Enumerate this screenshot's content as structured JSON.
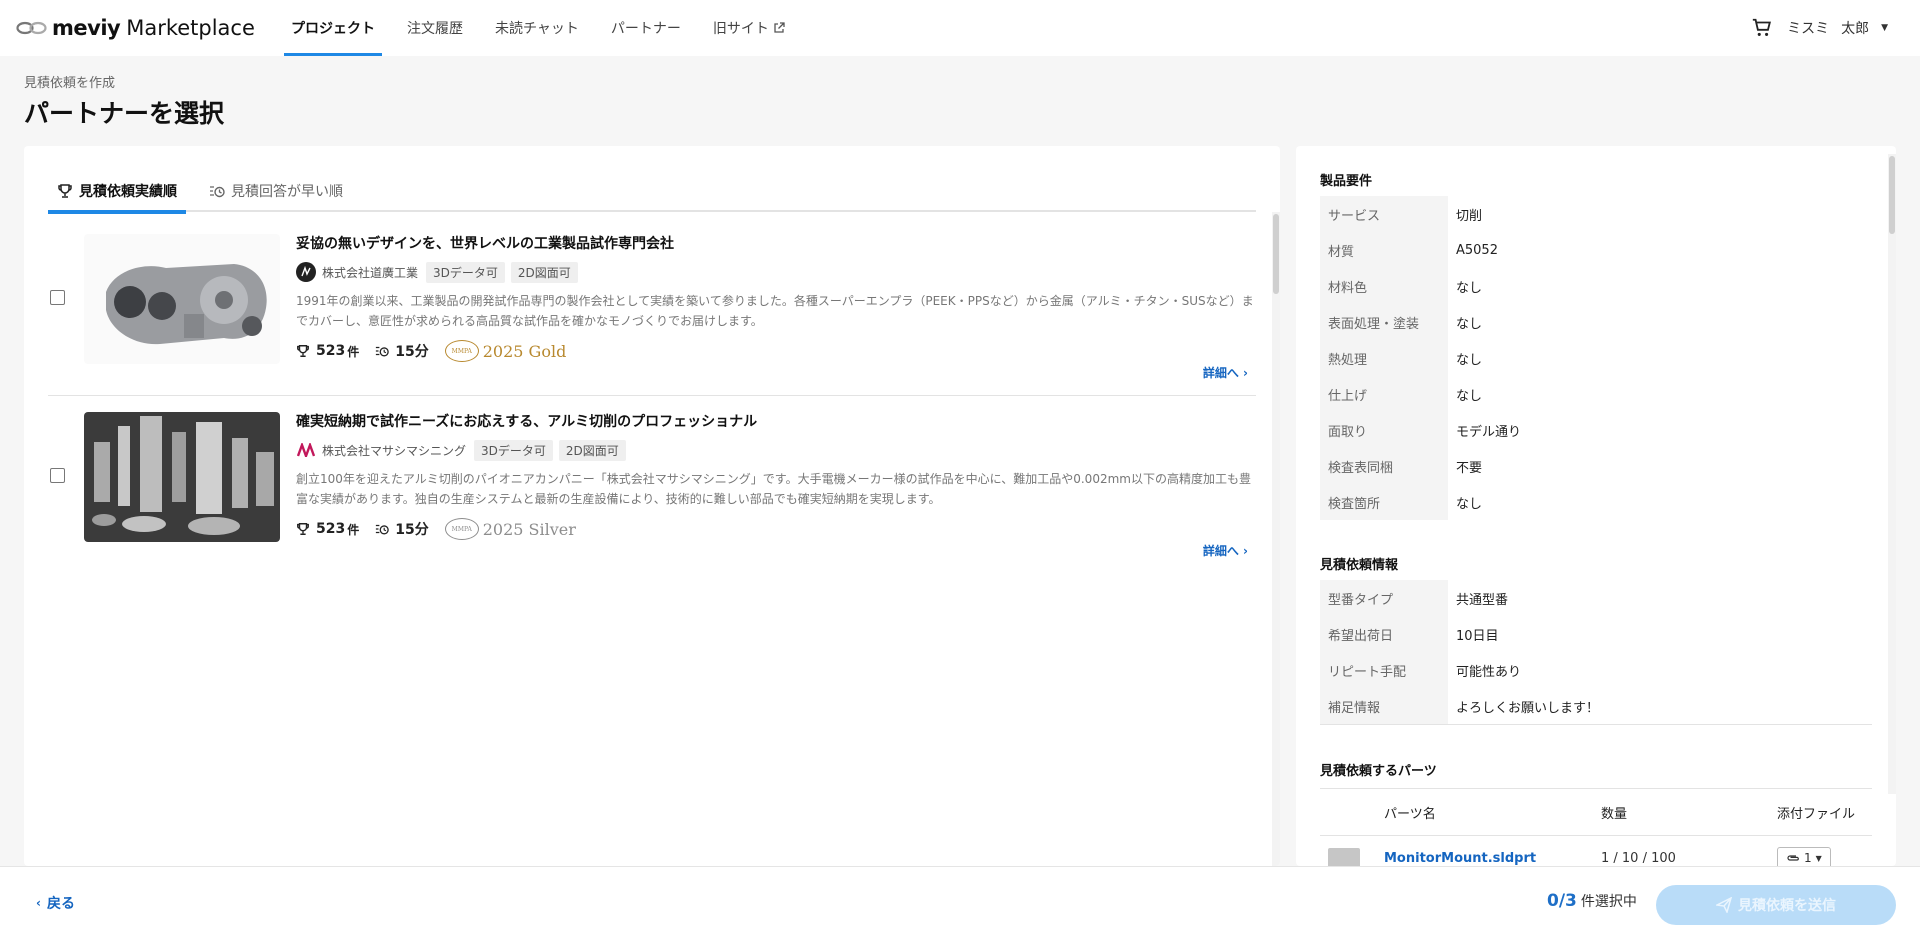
{
  "header": {
    "brand": "meviy",
    "product": "Marketplace",
    "nav": [
      {
        "label": "プロジェクト",
        "active": true
      },
      {
        "label": "注文履歴"
      },
      {
        "label": "未読チャット"
      },
      {
        "label": "パートナー"
      },
      {
        "label": "旧サイト"
      }
    ],
    "user": {
      "last_name": "ミスミ",
      "first_name": "太郎"
    }
  },
  "breadcrumb": "見積依頼を作成",
  "page_title": "パートナーを選択",
  "tabs": [
    {
      "label": "見積依頼実績順",
      "active": true,
      "icon": "trophy-icon"
    },
    {
      "label": "見積回答が早い順",
      "icon": "clock-list-icon"
    }
  ],
  "partners": [
    {
      "title": "妥協の無いデザインを、世界レベルの工業製品試作専門会社",
      "company": "株式会社道廣工業",
      "tags": [
        "3Dデータ可",
        "2D図面可"
      ],
      "description": "1991年の創業以来、工業製品の開発試作品専門の製作会社として実績を築いて参りました。各種スーパーエンプラ（PEEK・PPSなど）から金属（アルミ・チタン・SUSなど）までカバーし、意匠性が求められる高品質な試作品を確かなモノづくりでお届けします。",
      "count": "523",
      "count_unit": "件",
      "time": "15分",
      "badge_mark": "MMPA",
      "badge": "2025 Gold",
      "badge_color": "#b8892f",
      "detail": "詳細へ"
    },
    {
      "title": "確実短納期で試作ニーズにお応えする、アルミ切削のプロフェッショナル",
      "company": "株式会社マサシマシニング",
      "tags": [
        "3Dデータ可",
        "2D図面可"
      ],
      "description": "創立100年を迎えたアルミ切削のパイオニアカンパニー「株式会社マサシマシニング」です。大手電機メーカー様の試作品を中心に、難加工品や0.002mm以下の高精度加工も豊富な実績があります。独自の生産システムと最新の生産設備により、技術的に難しい部品でも確実短納期を実現します。",
      "count": "523",
      "count_unit": "件",
      "time": "15分",
      "badge_mark": "MMPA",
      "badge": "2025 Silver",
      "badge_color": "#8d8d8d",
      "detail": "詳細へ"
    }
  ],
  "requirements": {
    "title": "製品要件",
    "rows": [
      {
        "key": "サービス",
        "value": "切削"
      },
      {
        "key": "材質",
        "value": "A5052"
      },
      {
        "key": "材料色",
        "value": "なし"
      },
      {
        "key": "表面処理・塗装",
        "value": "なし"
      },
      {
        "key": "熱処理",
        "value": "なし"
      },
      {
        "key": "仕上げ",
        "value": "なし"
      },
      {
        "key": "面取り",
        "value": "モデル通り"
      },
      {
        "key": "検査表同梱",
        "value": "不要"
      },
      {
        "key": "検査箇所",
        "value": "なし"
      }
    ]
  },
  "quote_info": {
    "title": "見積依頼情報",
    "rows": [
      {
        "key": "型番タイプ",
        "value": "共通型番"
      },
      {
        "key": "希望出荷日",
        "value": "10日目"
      },
      {
        "key": "リピート手配",
        "value": "可能性あり"
      },
      {
        "key": "補足情報",
        "value": "よろしくお願いします！"
      }
    ]
  },
  "parts": {
    "title": "見積依頼するパーツ",
    "headers": {
      "name": "パーツ名",
      "qty": "数量",
      "file": "添付ファイル"
    },
    "rows": [
      {
        "name": "MonitorMount.sldprt",
        "qty": "1 / 10 / 100",
        "files": "1"
      }
    ]
  },
  "footer": {
    "back": "戻る",
    "selected": "0",
    "total": "/3",
    "selected_label": "件選択中",
    "send": "見積依頼を送信"
  },
  "colors": {
    "accent": "#1e88e5",
    "link": "#1565c0",
    "send_disabled": "#b9dcf8"
  }
}
